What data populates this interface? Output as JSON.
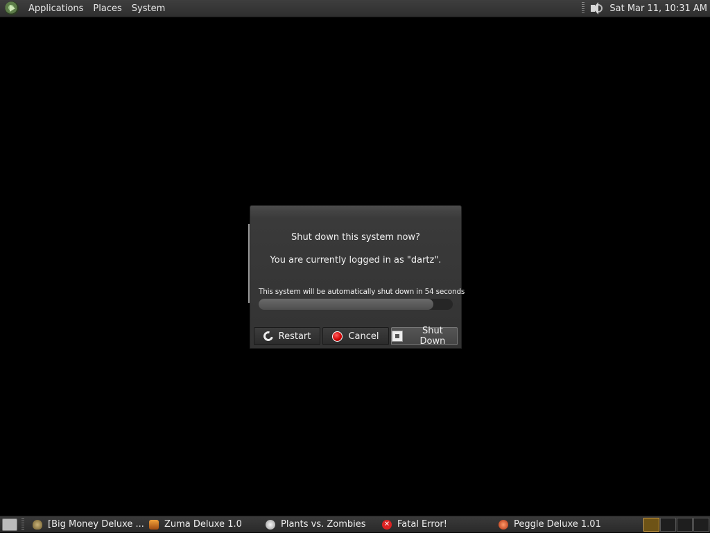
{
  "top_panel": {
    "menus": [
      "Applications",
      "Places",
      "System"
    ],
    "clock": "Sat Mar 11, 10:31 AM",
    "icons": [
      "distro-logo-icon",
      "volume-icon"
    ]
  },
  "dialog": {
    "title": "Shut down this system now?",
    "subtitle": "You are currently logged in as \"dartz\".",
    "countdown": "This system will be automatically shut down in 54 seconds",
    "progress_fraction": 0.9,
    "buttons": {
      "restart": "Restart",
      "cancel": "Cancel",
      "shutdown": "Shut Down"
    },
    "default_button": "shutdown"
  },
  "taskbar": {
    "tasks": [
      {
        "label": "[Big Money Deluxe ...",
        "icon": "money-bag-icon"
      },
      {
        "label": "Zuma Deluxe 1.0",
        "icon": "zuma-icon"
      },
      {
        "label": "Plants vs. Zombies",
        "icon": "pvz-icon"
      },
      {
        "label": "Fatal Error!",
        "icon": "error-icon"
      },
      {
        "label": "Peggle Deluxe 1.01",
        "icon": "peggle-icon"
      }
    ],
    "workspaces": 4,
    "active_workspace": 1
  },
  "colors": {
    "panel": "#333333",
    "dialog": "#3a3a3a",
    "error_red": "#d22222",
    "active_workspace": "#d4a040"
  }
}
